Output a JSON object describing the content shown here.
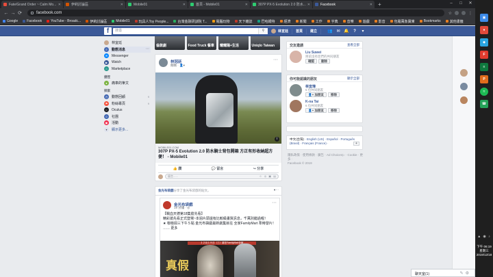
{
  "browser": {
    "tabs": [
      {
        "label": "Fate/Grand Order ~ Calm Mo...",
        "color": "#e74c3c",
        "active": false
      },
      {
        "label": "伊莉討論區",
        "color": "#d35400",
        "active": false
      },
      {
        "label": "Mobile01",
        "color": "#2ecc71",
        "active": false
      },
      {
        "label": "首頁 - Mobile01",
        "color": "#2ecc71",
        "active": false
      },
      {
        "label": "307P PX-5 Evolution 2.0 防水...",
        "color": "#2ecc71",
        "active": false
      },
      {
        "label": "Facebook",
        "color": "#3b5998",
        "active": true
      }
    ],
    "url": "facebook.com",
    "bookmarks": [
      {
        "label": "Google",
        "color": "#4285f4"
      },
      {
        "label": "Facebook",
        "color": "#3b5998"
      },
      {
        "label": "YouTube - Broadc...",
        "color": "#e62117"
      },
      {
        "label": "伊莉討論區",
        "color": "#d35400"
      },
      {
        "label": "Mobile01",
        "color": "#2ecc71"
      },
      {
        "label": "玩具人Toy People...",
        "color": "#c0392b"
      },
      {
        "label": "台灣金融研訓院 T...",
        "color": "#27ae60"
      },
      {
        "label": "電腦玩物",
        "color": "#f39c12"
      },
      {
        "label": "天下雜誌",
        "color": "#c0392b"
      },
      {
        "label": "巴哈姆特",
        "color": "#16a085"
      },
      {
        "label": "經濟",
        "color": "#e67e22"
      },
      {
        "label": "新聞",
        "color": "#e67e22"
      },
      {
        "label": "工作",
        "color": "#e67e22"
      },
      {
        "label": "字典",
        "color": "#e67e22"
      },
      {
        "label": "音樂",
        "color": "#e67e22"
      },
      {
        "label": "遊戲",
        "color": "#e67e22"
      },
      {
        "label": "影音",
        "color": "#e67e22"
      },
      {
        "label": "包羅萬象寶庫",
        "color": "#e67e22"
      },
      {
        "label": "Bookmarks",
        "color": "#e67e22"
      },
      {
        "label": "其他書籤",
        "color": "#e67e22"
      }
    ]
  },
  "fb": {
    "search_placeholder": "搜尋",
    "nav": {
      "user": "林宜廷",
      "home": "首頁",
      "create": "建立"
    },
    "left": {
      "user": "林宜廷",
      "items": [
        {
          "label": "動態消息",
          "color": "#4267b2",
          "glyph": "≡"
        },
        {
          "label": "Messenger",
          "color": "#0084ff",
          "glyph": "✉"
        },
        {
          "label": "Watch",
          "color": "#3b5998",
          "glyph": "▶"
        },
        {
          "label": "Marketplace",
          "color": "#2c9a8d",
          "glyph": "⌂"
        }
      ],
      "shortcuts_header": "捷徑",
      "shortcuts": [
        {
          "label": "痛車的筆文",
          "color": "#7cb342",
          "glyph": "●"
        }
      ],
      "explore_header": "探索",
      "explore": [
        {
          "label": "動態回顧",
          "color": "#4267b2",
          "glyph": "◷",
          "count": "9"
        },
        {
          "label": "粉絲專頁",
          "color": "#f5533d",
          "glyph": "⚑",
          "count": "9"
        },
        {
          "label": "Oculus",
          "color": "#1c1e21",
          "glyph": "○",
          "count": ""
        },
        {
          "label": "社團",
          "color": "#4267b2",
          "glyph": "☺",
          "count": ""
        },
        {
          "label": "活動",
          "color": "#f02849",
          "glyph": "▣",
          "count": ""
        }
      ],
      "see_more": "顯示更多..."
    },
    "stories": [
      "倫敦劇",
      "Food Truck 餐車",
      "耀耀陽+生活",
      "Uniqlo Taiwan"
    ],
    "post1": {
      "author": "林冠廷",
      "time": "剛剛 · ",
      "link_domain": "MOBILE01.COM",
      "link_title": "307P PX-5 Evolution 2.0 防水騎士背包開箱 方正有形收納超方便！ - Mobile01",
      "like": "讚",
      "comment": "留言",
      "share": "分享",
      "comment_placeholder": "留言......",
      "comment_icons": "☺ ◎ ▣ ▤"
    },
    "post2": {
      "sharer_line": "金光布袋戲 分享了金光布袋戲的貼文。",
      "sharer": "金光布袋戲",
      "sharer_rest": "分享了金光布袋戲的貼文。",
      "author": "金光布袋戲",
      "time": "19 分鐘 · ",
      "text1": "【戰血天德第18集搶先看】",
      "text2": "精彩搶先看正式登場~本週片頭還有比較級畫質訊息，千萬別錯過喔！",
      "text3": "★ 咖咖週三下午５點 金光布袋戲最新劇集就在 全家FamilyMart 準時發片！ …… 更多",
      "text3_more": "更多",
      "banner": "１２月１８日（三）將在FamilyMart全家",
      "big_text": "真假"
    },
    "right": {
      "friends_header": "交友邀請",
      "friends_link": "查看全部",
      "request": {
        "name": "Liu Suwei",
        "meta": "目前沒有您們的共同朋友",
        "confirm": "確認",
        "delete": "刪除"
      },
      "pymk_header": "你可能認識的朋友",
      "pymk_link": "顯示全部",
      "people": [
        {
          "name": "林宜瑋",
          "meta": "5 位共同朋友",
          "add": "加朋友",
          "remove": "移除"
        },
        {
          "name": "K-na Tai",
          "meta": "6 位共同朋友",
          "add": "加朋友",
          "remove": "移除"
        }
      ],
      "lang_current": "中文(台灣)",
      "lang_options": "· English (US) · Español · Português (Brasil) · Français (France) ·",
      "footer": "隱私政策 · 使用條款 · 廣告 · Ad Choices▷ · Cookie · 更多 ·",
      "copyright": "Facebook © 2019"
    },
    "chat": {
      "label": "聊天室(1)"
    }
  },
  "system": {
    "time": "下午 06:19",
    "day": "星期三",
    "date": "2019/12/18"
  }
}
